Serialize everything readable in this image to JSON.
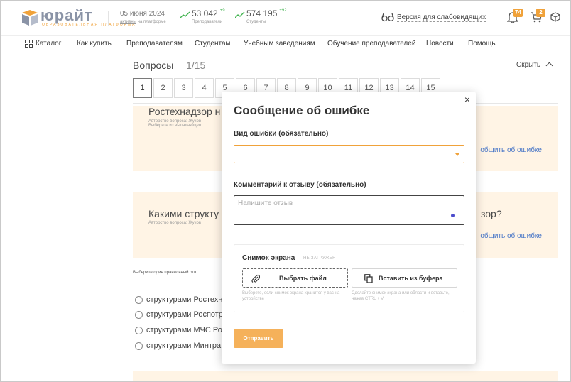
{
  "header": {
    "logo_word": "юрайт",
    "logo_sub": "ОБРАЗОВАТЕЛЬНАЯ ПЛАТФОРМА",
    "date": "05 июня 2024",
    "date_sub_link": "активны",
    "date_sub_rest": "на платформе",
    "stat_teachers": {
      "value": "53 042",
      "inc": "+9",
      "label": "Преподаватели"
    },
    "stat_students": {
      "value": "574 195",
      "inc": "+92",
      "label": "Студенты"
    },
    "vision_label": "Версия для слабовидящих",
    "bell_badge": "74",
    "cart_badge": "2",
    "accent_color": "#f0a23a"
  },
  "nav": {
    "catalog": "Каталог",
    "items": [
      "Как купить",
      "Преподавателям",
      "Студентам",
      "Учебным заведениям",
      "Обучение преподавателей",
      "Новости",
      "Помощь"
    ]
  },
  "questions": {
    "title": "Вопросы",
    "count": "1/15",
    "hide_label": "Скрыть",
    "pages": [
      "1",
      "2",
      "3",
      "4",
      "5",
      "6",
      "7",
      "8",
      "9",
      "10",
      "11",
      "12",
      "13",
      "14",
      "15"
    ],
    "active_page": "1",
    "card1": {
      "question": "Ростехнадзор н",
      "author": "Авторство вопроса: Жуков",
      "author2": "Выберите из выпадающего",
      "report": "общить об ошибке"
    },
    "card2": {
      "question": "Какими структу",
      "tail": "зор?",
      "author": "Авторство вопроса: Жуков",
      "report": "общить об ошибке"
    },
    "choose_label": "Выберите один правильный отв",
    "options": [
      "структурами Ростехн",
      "структурами Роспотр",
      "структурами МЧС Ро",
      "структурами Минтра"
    ]
  },
  "modal": {
    "title": "Сообщение об ошибке",
    "close": "×",
    "error_type_label": "Вид ошибки (обязательно)",
    "comment_label": "Комментарий к отзыву (обязательно)",
    "comment_placeholder": "Напишите отзыв",
    "screenshot_title": "Снимок экрана",
    "screenshot_state": "НЕ ЗАГРУЖЕН",
    "choose_file": "Выбрать файл",
    "paste_clipboard": "Вставить из буфера",
    "hint_file": "Выберете, если снимок экрана хранится у вас на устройстве",
    "hint_paste": "Сделайте снимок экрана или области и вставьте, нажав CTRL + V",
    "send": "Отправить"
  }
}
